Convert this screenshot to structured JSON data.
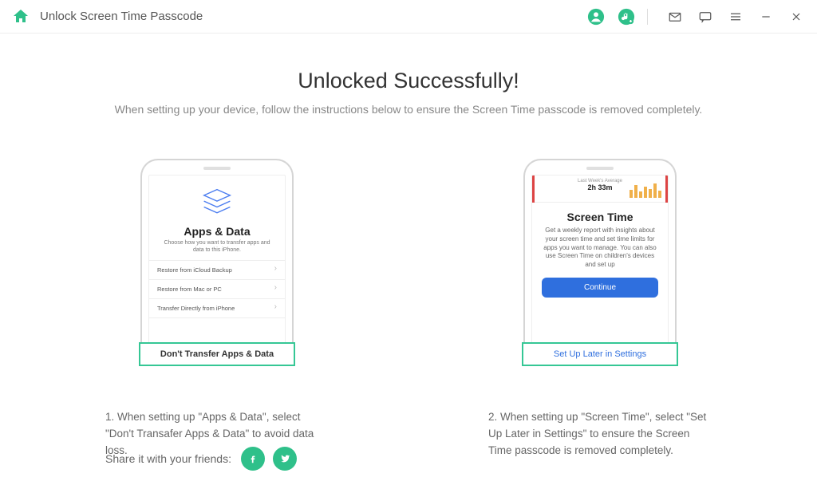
{
  "titlebar": {
    "title": "Unlock Screen Time Passcode"
  },
  "main": {
    "heading": "Unlocked Successfully!",
    "subheading": "When setting up your device, follow the instructions below to ensure the Screen Time passcode is removed completely."
  },
  "phone1": {
    "title": "Apps & Data",
    "subtitle": "Choose how you want to transfer apps and data to this iPhone.",
    "options": [
      "Restore from iCloud Backup",
      "Restore from Mac or PC",
      "Transfer Directly from iPhone"
    ],
    "highlight": "Don't Transfer Apps & Data",
    "caption": "1. When setting up \"Apps & Data\", select \"Don't Transafer Apps & Data\" to avoid data loss."
  },
  "phone2": {
    "stat_label": "Last Week's Average",
    "stat_value": "2h 33m",
    "title": "Screen Time",
    "desc": "Get a weekly report with insights about your screen time and set time limits for apps you want to manage. You can also use Screen Time on children's devices and set up",
    "continue": "Continue",
    "highlight": "Set Up Later in Settings",
    "caption": "2. When setting up \"Screen Time\", select \"Set Up Later in Settings\" to ensure the Screen Time passcode is removed completely."
  },
  "share": {
    "label": "Share it with your friends:"
  }
}
